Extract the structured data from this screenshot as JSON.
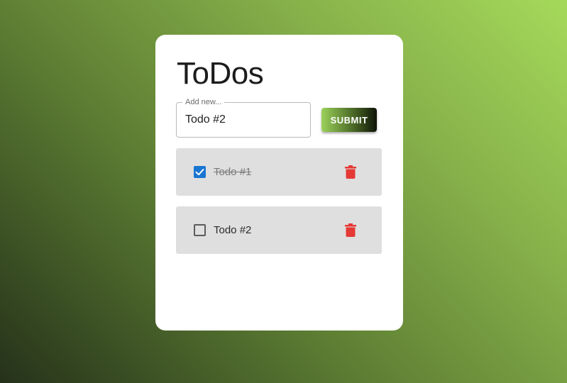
{
  "app": {
    "title": "ToDos"
  },
  "form": {
    "legend": "Add new...",
    "input_value": "Todo #2",
    "submit_label": "SUBMIT"
  },
  "todos": [
    {
      "label": "Todo #1",
      "completed": true
    },
    {
      "label": "Todo #2",
      "completed": false
    }
  ],
  "icons": {
    "delete": "trash-icon",
    "checked": "checkbox-checked-icon",
    "unchecked": "checkbox-unchecked-icon"
  },
  "colors": {
    "accent": "#1976d2",
    "delete": "#e53935",
    "item_bg": "#dfdfdf",
    "card_bg": "#ffffff"
  }
}
